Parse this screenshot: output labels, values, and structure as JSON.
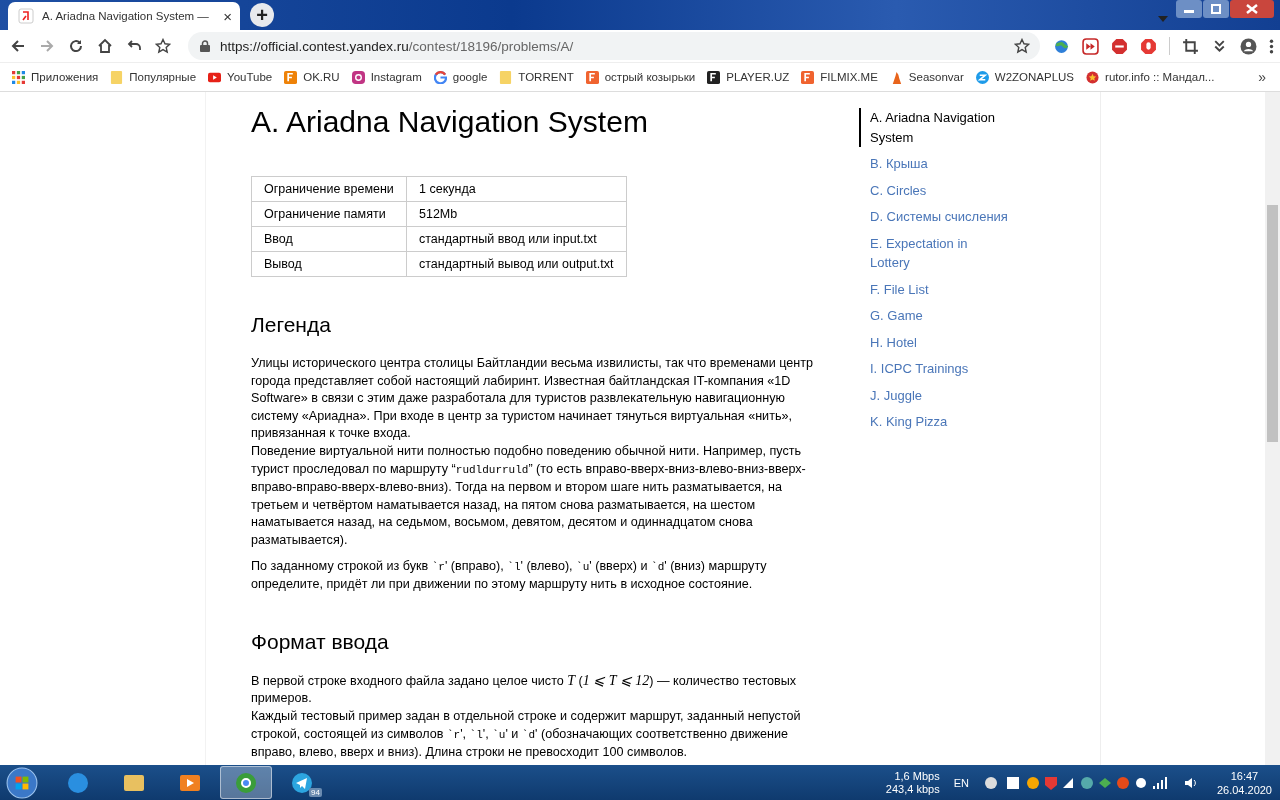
{
  "browser": {
    "tab": {
      "title": "A. Ariadna Navigation System —",
      "close": "×"
    },
    "new_tab": "+",
    "url": {
      "host": "https://official.contest.yandex.ru",
      "path": "/contest/18196/problems/A/"
    }
  },
  "bookmarks": [
    {
      "label": "Приложения",
      "kind": "apps"
    },
    {
      "label": "Популярные",
      "kind": "folder"
    },
    {
      "label": "YouTube",
      "kind": "youtube"
    },
    {
      "label": "OK.RU",
      "kind": "ok"
    },
    {
      "label": "Instagram",
      "kind": "instagram"
    },
    {
      "label": "google",
      "kind": "google"
    },
    {
      "label": "TORRENT",
      "kind": "folder"
    },
    {
      "label": "острый козырьки",
      "kind": "orange"
    },
    {
      "label": "PLAYER.UZ",
      "kind": "player"
    },
    {
      "label": "FILMIX.ME",
      "kind": "orange"
    },
    {
      "label": "Seasonvar",
      "kind": "seasonvar"
    },
    {
      "label": "W2ZONAPLUS",
      "kind": "zona"
    },
    {
      "label": "rutor.info :: Мандал...",
      "kind": "rutor"
    }
  ],
  "bookmarks_more": "»",
  "problem": {
    "title": "A. Ariadna Navigation System",
    "limits": [
      {
        "label": "Ограничение времени",
        "value": "1 секунда"
      },
      {
        "label": "Ограничение памяти",
        "value": "512Mb"
      },
      {
        "label": "Ввод",
        "value": "стандартный ввод или input.txt"
      },
      {
        "label": "Вывод",
        "value": "стандартный вывод или output.txt"
      }
    ],
    "sections": [
      {
        "heading": "Легенда",
        "paragraphs": [
          {
            "lines": [
              [
                {
                  "kind": "text",
                  "text": "Улицы исторического центра столицы Байтландии весьма извилисты, так что временами центр города представляет собой настоящий лабиринт. Известная байтландская IT-компания «1D Software» в связи с этим даже разработала для туристов развлекательную навигационную систему «Ариадна». При входе в центр за туристом начинает тянуться виртуальная «нить», привязанная к точке входа."
                }
              ],
              [
                {
                  "kind": "text",
                  "text": "Поведение виртуальной нити полностью подобно поведению обычной нити. Например, пусть турист проследовал по маршруту “"
                },
                {
                  "kind": "code",
                  "text": "rudldurruld"
                },
                {
                  "kind": "text",
                  "text": "” (то есть вправо-вверх-вниз-влево-вниз-вверх-вправо-вправо-вверх-влево-вниз). Тогда на первом и втором шаге нить разматывается, на третьем и четвёртом наматывается назад, на пятом снова разматывается, на шестом наматывается назад, на седьмом, восьмом, девятом, десятом и одиннадцатом снова разматывается)."
                }
              ]
            ]
          },
          {
            "lines": [
              [
                {
                  "kind": "text",
                  "text": "По заданному строкой из букв "
                },
                {
                  "kind": "code",
                  "text": "`r"
                },
                {
                  "kind": "text",
                  "text": "' (вправо), "
                },
                {
                  "kind": "code",
                  "text": "`l"
                },
                {
                  "kind": "text",
                  "text": "' (влево), "
                },
                {
                  "kind": "code",
                  "text": "`u"
                },
                {
                  "kind": "text",
                  "text": "' (вверх) и "
                },
                {
                  "kind": "code",
                  "text": "`d"
                },
                {
                  "kind": "text",
                  "text": "' (вниз) маршруту определите, придёт ли при движении по этому маршруту нить в исходное состояние."
                }
              ]
            ]
          }
        ]
      },
      {
        "heading": "Формат ввода",
        "paragraphs": [
          {
            "lines": [
              [
                {
                  "kind": "text",
                  "text": "В первой строке входного файла задано целое чисто "
                },
                {
                  "kind": "math",
                  "text": "T"
                },
                {
                  "kind": "text",
                  "text": " ("
                },
                {
                  "kind": "math",
                  "text": "1 ⩽ T ⩽ 12"
                },
                {
                  "kind": "text",
                  "text": ") — количество тестовых примеров."
                }
              ],
              [
                {
                  "kind": "text",
                  "text": "Каждый тестовый пример задан в отдельной строке и содержит маршрут, заданный непустой строкой, состоящей из символов "
                },
                {
                  "kind": "code",
                  "text": "`r"
                },
                {
                  "kind": "text",
                  "text": "', "
                },
                {
                  "kind": "code",
                  "text": "`l"
                },
                {
                  "kind": "text",
                  "text": "', "
                },
                {
                  "kind": "code",
                  "text": "`u"
                },
                {
                  "kind": "text",
                  "text": "' и "
                },
                {
                  "kind": "code",
                  "text": "`d"
                },
                {
                  "kind": "text",
                  "text": "' (обозначающих соответственно движение вправо, влево, вверх и вниз). Длина строки не превосходит 100 символов."
                }
              ]
            ]
          }
        ]
      }
    ]
  },
  "problems_nav": [
    {
      "label": "A. Ariadna Navigation System",
      "selected": true
    },
    {
      "label": "B. Крыша",
      "selected": false
    },
    {
      "label": "C. Circles",
      "selected": false
    },
    {
      "label": "D. Системы счисления",
      "selected": false
    },
    {
      "label": "E. Expectation in Lottery",
      "selected": false
    },
    {
      "label": "F. File List",
      "selected": false
    },
    {
      "label": "G. Game",
      "selected": false
    },
    {
      "label": "H. Hotel",
      "selected": false
    },
    {
      "label": "I. ICPC Trainings",
      "selected": false
    },
    {
      "label": "J. Juggle",
      "selected": false
    },
    {
      "label": "K. King Pizza",
      "selected": false
    }
  ],
  "taskbar": {
    "apps": [
      {
        "kind": "ie",
        "active": false
      },
      {
        "kind": "explorer",
        "active": false
      },
      {
        "kind": "media",
        "active": false
      },
      {
        "kind": "chrome",
        "active": true
      },
      {
        "kind": "telegram",
        "active": false,
        "badge": "94"
      }
    ],
    "net_down": "1,6 Mbps",
    "net_up": "243,4 kbps",
    "lang": "EN",
    "time": "16:47",
    "date": "26.04.2020"
  }
}
